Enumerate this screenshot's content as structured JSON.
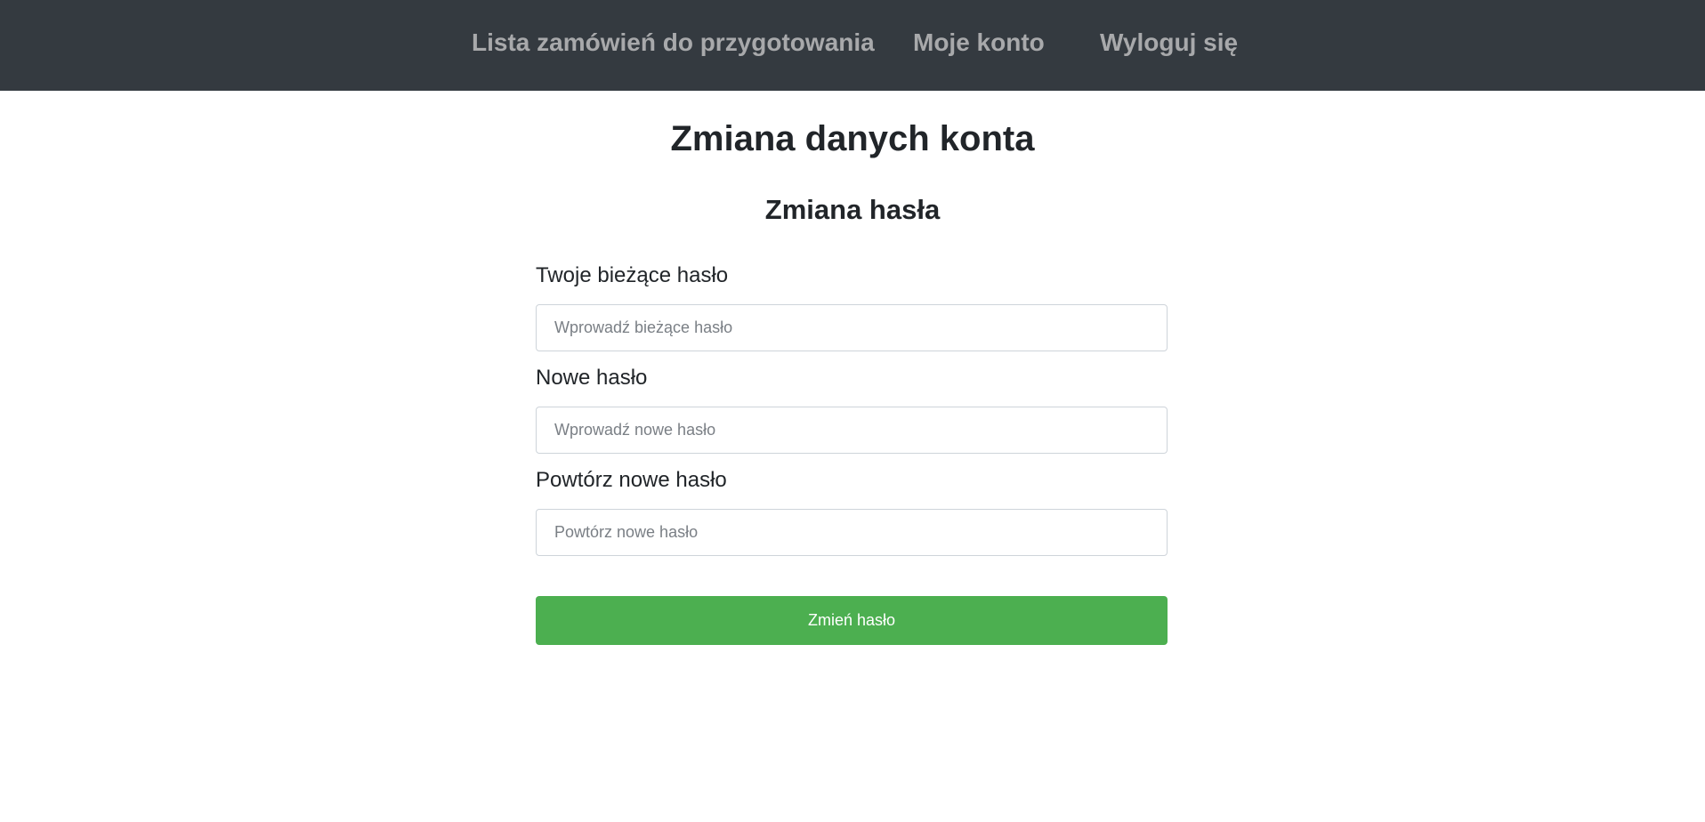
{
  "nav": {
    "orders_label": "Lista zamówień do przygotowania",
    "account_label": "Moje konto",
    "logout_label": "Wyloguj się"
  },
  "page": {
    "title": "Zmiana danych konta"
  },
  "password_form": {
    "title": "Zmiana hasła",
    "current": {
      "label": "Twoje bieżące hasło",
      "placeholder": "Wprowadź bieżące hasło",
      "value": ""
    },
    "new": {
      "label": "Nowe hasło",
      "placeholder": "Wprowadź nowe hasło",
      "value": ""
    },
    "repeat": {
      "label": "Powtórz nowe hasło",
      "placeholder": "Powtórz nowe hasło",
      "value": ""
    },
    "submit_label": "Zmień hasło"
  },
  "colors": {
    "navbar_bg": "#343a40",
    "nav_link": "#a8a9ab",
    "primary_button": "#4caf50",
    "text": "#212529"
  }
}
